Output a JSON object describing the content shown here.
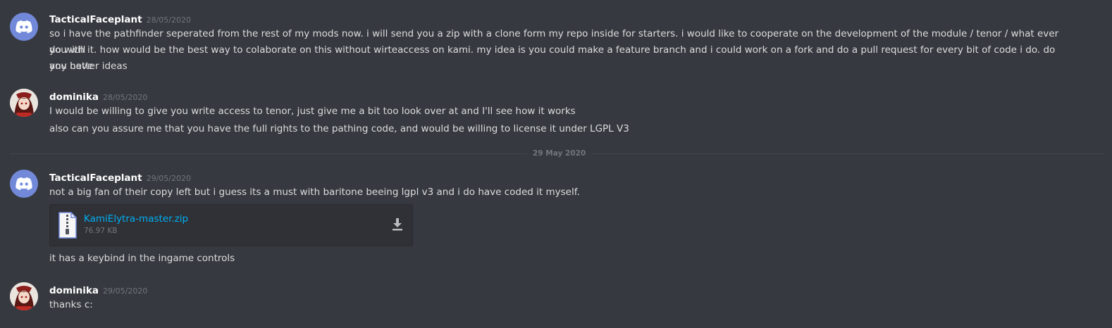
{
  "messages": [
    {
      "author": "TacticalFaceplant",
      "timestamp": "28/05/2020",
      "avatar": "discord-logo-icon",
      "lines": [
        "so i have the pathfinder seperated from the rest of my mods now. i will send you a zip with a clone form my repo inside for starters.  i would like to cooperate on the development of the module / tenor / what ever you will",
        "do with it. how would be the best way to colaborate on this without wirteaccess on kami. my idea is  you could make a feature branch and i could work on a fork  and do a pull request for every bit of code i do. do you have",
        "any better ideas"
      ]
    },
    {
      "author": "dominika",
      "timestamp": "28/05/2020",
      "avatar": "anime-avatar-icon",
      "lines": [
        "I would be willing to give you write access to tenor, just give me a bit too look over at and I'll see how it works",
        "also can you assure me that you have the full rights to the pathing code, and would be willing to license it under LGPL V3"
      ]
    },
    {
      "author": "TacticalFaceplant",
      "timestamp": "29/05/2020",
      "avatar": "discord-logo-icon",
      "lines": [
        "not a big fan of their copy left but i guess its a must with baritone beeing lgpl v3 and i do have coded it myself.",
        "it has a keybind in the ingame controls"
      ],
      "attachment": {
        "filename": "KamiElytra-master.zip",
        "size": "76.97 KB",
        "icon": "zip-file-icon",
        "action_icon": "download-icon"
      }
    },
    {
      "author": "dominika",
      "timestamp": "29/05/2020",
      "avatar": "anime-avatar-icon",
      "lines": [
        "thanks c:"
      ]
    }
  ],
  "date_divider": "29 May 2020",
  "colors": {
    "background": "#36393f",
    "username": "#ffffff",
    "text": "#dcddde",
    "timestamp": "#72767d",
    "link": "#00aff4",
    "discord_blurple": "#7289da"
  }
}
